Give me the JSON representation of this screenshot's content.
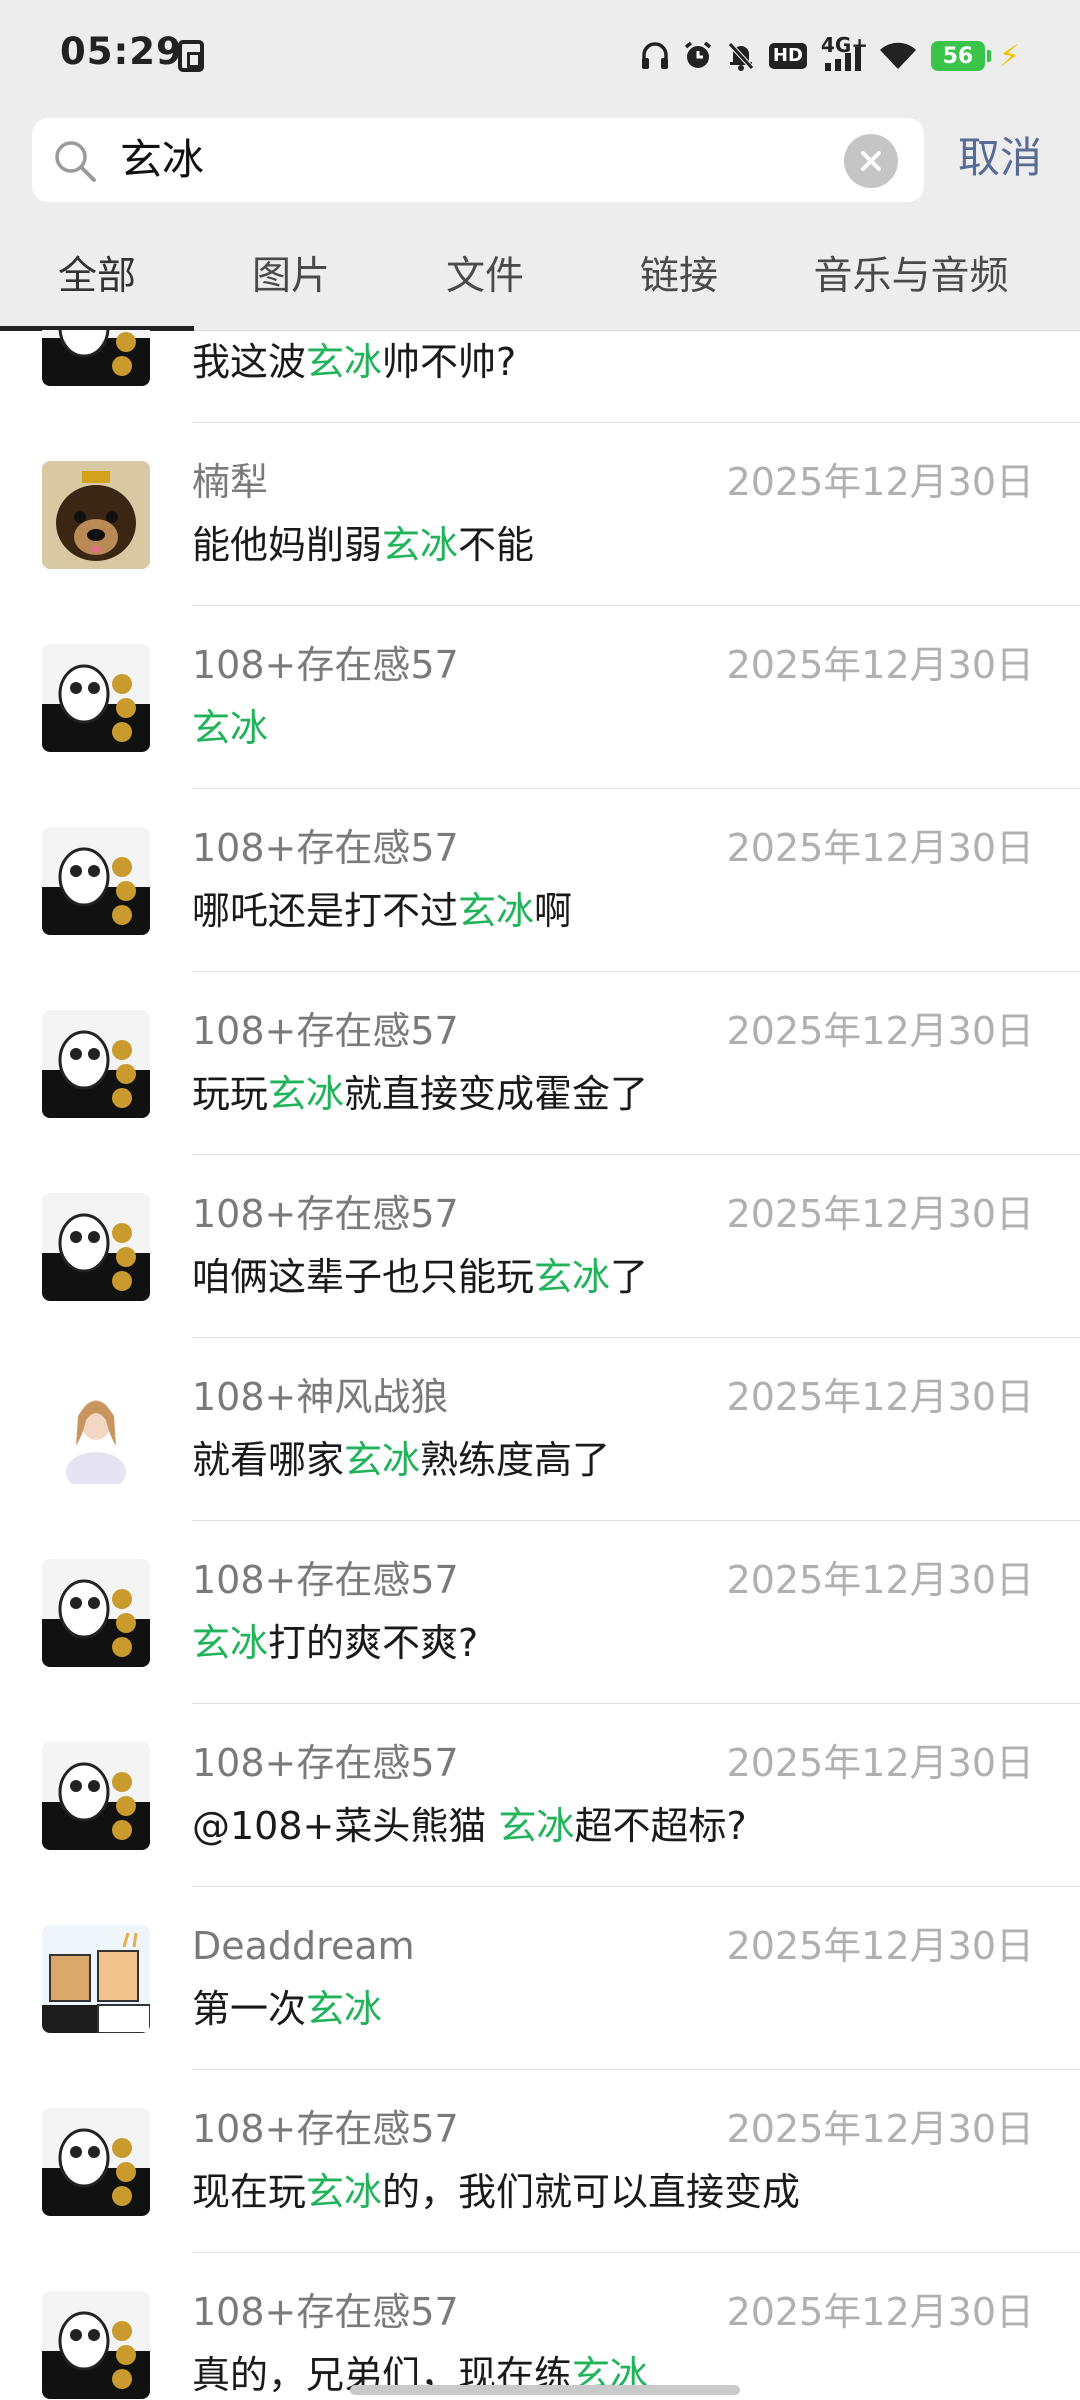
{
  "status_bar": {
    "time": "05:29",
    "network": "4G+",
    "hd": "HD",
    "battery": "56"
  },
  "search": {
    "query": "玄冰",
    "cancel_label": "取消"
  },
  "tabs": [
    {
      "label": "全部",
      "active": true
    },
    {
      "label": "图片",
      "active": false
    },
    {
      "label": "文件",
      "active": false
    },
    {
      "label": "链接",
      "active": false
    },
    {
      "label": "音乐与音频",
      "active": false
    }
  ],
  "results": [
    {
      "sender": "",
      "date": "",
      "pre": "我这波",
      "kw": "玄冰",
      "post": "帅不帅?",
      "avatar": "meme-avatar"
    },
    {
      "sender": "楠犁",
      "date": "2025年12月30日",
      "pre": "能他妈削弱",
      "kw": "玄冰",
      "post": "不能",
      "avatar": "puppy-avatar"
    },
    {
      "sender": "108+存在感57",
      "date": "2025年12月30日",
      "pre": "",
      "kw": "玄冰",
      "post": "",
      "avatar": "meme-avatar"
    },
    {
      "sender": "108+存在感57",
      "date": "2025年12月30日",
      "pre": "哪吒还是打不过",
      "kw": "玄冰",
      "post": "啊",
      "avatar": "meme-avatar"
    },
    {
      "sender": "108+存在感57",
      "date": "2025年12月30日",
      "pre": "玩玩",
      "kw": "玄冰",
      "post": "就直接变成霍金了",
      "avatar": "meme-avatar"
    },
    {
      "sender": "108+存在感57",
      "date": "2025年12月30日",
      "pre": "咱俩这辈子也只能玩",
      "kw": "玄冰",
      "post": "了",
      "avatar": "meme-avatar"
    },
    {
      "sender": "108+神风战狼",
      "date": "2025年12月30日",
      "pre": "就看哪家",
      "kw": "玄冰",
      "post": "熟练度高了",
      "avatar": "girl-avatar"
    },
    {
      "sender": "108+存在感57",
      "date": "2025年12月30日",
      "pre": "",
      "kw": "玄冰",
      "post": "打的爽不爽?",
      "avatar": "meme-avatar"
    },
    {
      "sender": "108+存在感57",
      "date": "2025年12月30日",
      "pre": "@108+菜头熊猫 ",
      "kw": "玄冰",
      "post": "超不超标?",
      "avatar": "meme-avatar"
    },
    {
      "sender": "Deaddream",
      "date": "2025年12月30日",
      "pre": "第一次",
      "kw": "玄冰",
      "post": "",
      "avatar": "cartoon-avatar"
    },
    {
      "sender": "108+存在感57",
      "date": "2025年12月30日",
      "pre": "现在玩",
      "kw": "玄冰",
      "post": "的，我们就可以直接变成",
      "avatar": "meme-avatar"
    },
    {
      "sender": "108+存在感57",
      "date": "2025年12月30日",
      "pre": "真的，兄弟们，现在练",
      "kw": "玄冰",
      "post": "",
      "avatar": "meme-avatar"
    }
  ],
  "colors": {
    "highlight": "#20b35a",
    "cancel": "#576b95",
    "header_bg": "#ededed"
  }
}
